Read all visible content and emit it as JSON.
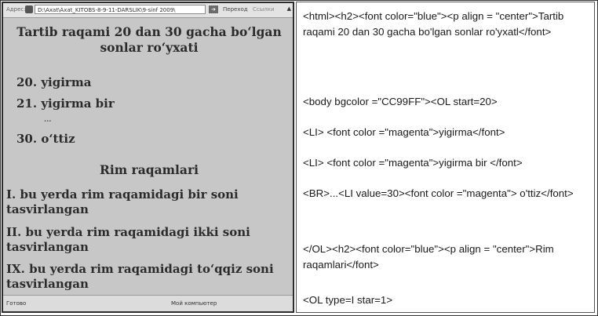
{
  "browser": {
    "address_label": "Адрес:",
    "url": "D:\\Axat\\Axat_KITOBS-8-9-11-DARSLIK\\9-sinf 2009\\",
    "go_label": "Переход",
    "links_label": "Ссылки",
    "status_left": "Готово",
    "status_right": "Мой компьютер"
  },
  "page": {
    "title": "Tartib raqami 20 dan 30 gacha bo‘lgan sonlar ro‘yxati",
    "items": [
      "20. yigirma",
      "21. yigirma bir",
      "30. o‘ttiz"
    ],
    "ellipsis": "...",
    "rim_title": "Rim raqamlari",
    "rim_items": [
      "I. bu yerda rim raqamidagi bir soni tasvirlangan",
      "II. bu yerda rim raqamidagi ikki soni tasvirlangan",
      "IX. bu yerda rim raqamidagi to‘qqiz soni tasvirlangan"
    ],
    "bg_color": "#c7c7c7"
  },
  "code": {
    "lines": [
      "<html><h2><font color=\"blue\"><p align = \"center\">Tartib raqami 20 dan 30 gacha bo'lgan sonlar ro'yxatl</font>",
      "<body  bgcolor =\"CC99FF\"><OL start=20>",
      "<LI> <font color =\"magenta\">yigirma</font>",
      "<LI> <font color =\"magenta\">yigirma bir </font>",
      "<BR>...<LI value=30><font color =\"magenta\"> o'ttiz</font>",
      "</OL><h2><font color=\"blue\"><p align = \"center\">Rim raqamlari</font>",
      "<OL type=I star=1>"
    ]
  }
}
